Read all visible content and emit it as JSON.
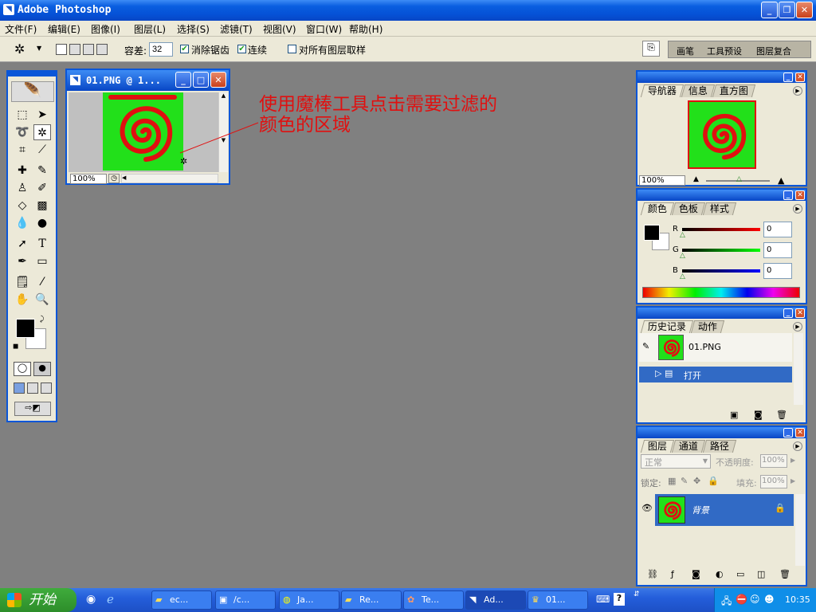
{
  "window": {
    "title": "Adobe Photoshop"
  },
  "menu": [
    "文件(F)",
    "编辑(E)",
    "图像(I)",
    "图层(L)",
    "选择(S)",
    "滤镜(T)",
    "视图(V)",
    "窗口(W)",
    "帮助(H)"
  ],
  "options": {
    "tolerance_label": "容差:",
    "tolerance_value": "32",
    "antialias": "消除锯齿",
    "contiguous": "连续",
    "all_layers": "对所有图层取样"
  },
  "palette_well": [
    "画笔",
    "工具预设",
    "图层复合"
  ],
  "document": {
    "title": "01.PNG @ 1...",
    "zoom": "100%"
  },
  "annotation": "使用魔棒工具点击需要过滤的\n颜色的区域",
  "navigator": {
    "tabs": [
      "导航器",
      "信息",
      "直方图"
    ],
    "zoom": "100%"
  },
  "color": {
    "tabs": [
      "颜色",
      "色板",
      "样式"
    ],
    "r_label": "R",
    "g_label": "G",
    "b_label": "B",
    "r": "0",
    "g": "0",
    "b": "0"
  },
  "history": {
    "tabs": [
      "历史记录",
      "动作"
    ],
    "snapshot": "01.PNG",
    "step": "打开"
  },
  "layers": {
    "tabs": [
      "图层",
      "通道",
      "路径"
    ],
    "blend_mode": "正常",
    "opacity_label": "不透明度:",
    "opacity": "100%",
    "lock_label": "锁定:",
    "fill_label": "填充:",
    "fill": "100%",
    "layer_name": "背景"
  },
  "taskbar": {
    "start": "开始",
    "tasks": [
      "ec...",
      "/c...",
      "Ja...",
      "Re...",
      "Te...",
      "Ad...",
      "01..."
    ],
    "clock": "10:35"
  },
  "colors": {
    "accent": "#0a56d8",
    "spiral_bg": "#22e01a",
    "spiral": "#e01010"
  }
}
